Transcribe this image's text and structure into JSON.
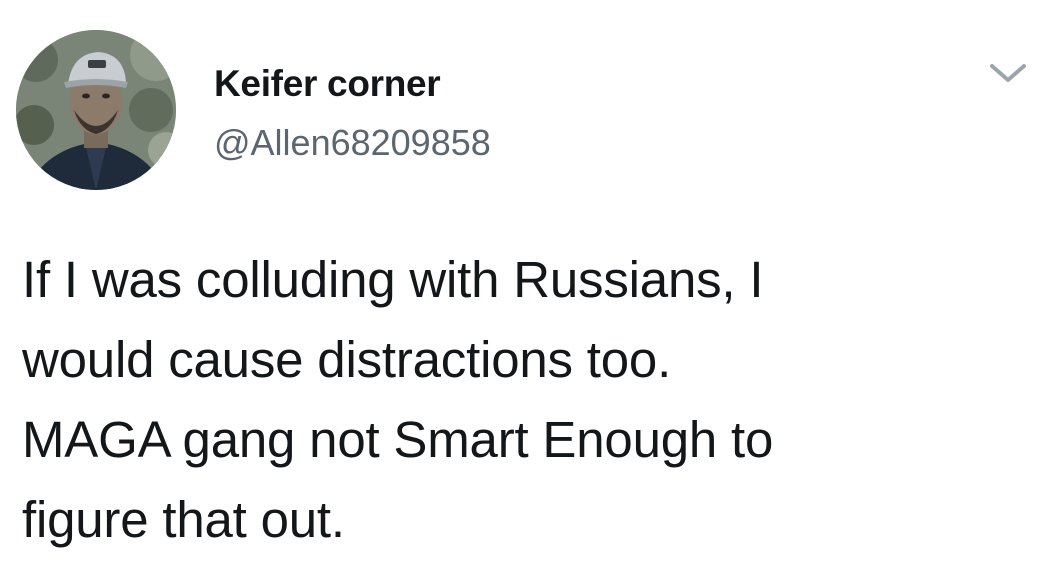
{
  "tweet": {
    "author": {
      "display_name": "Keifer corner",
      "handle": "@Allen68209858",
      "avatar_icon": "profile-photo"
    },
    "menu_icon": "chevron-down-icon",
    "text_lines": [
      "If I was colluding with Russians,  I",
      "would cause distractions too.",
      "MAGA gang not Smart Enough to",
      "figure that out."
    ]
  },
  "colors": {
    "name": "#14171a",
    "handle": "#5b6670",
    "chevron": "#9aa5ad"
  }
}
